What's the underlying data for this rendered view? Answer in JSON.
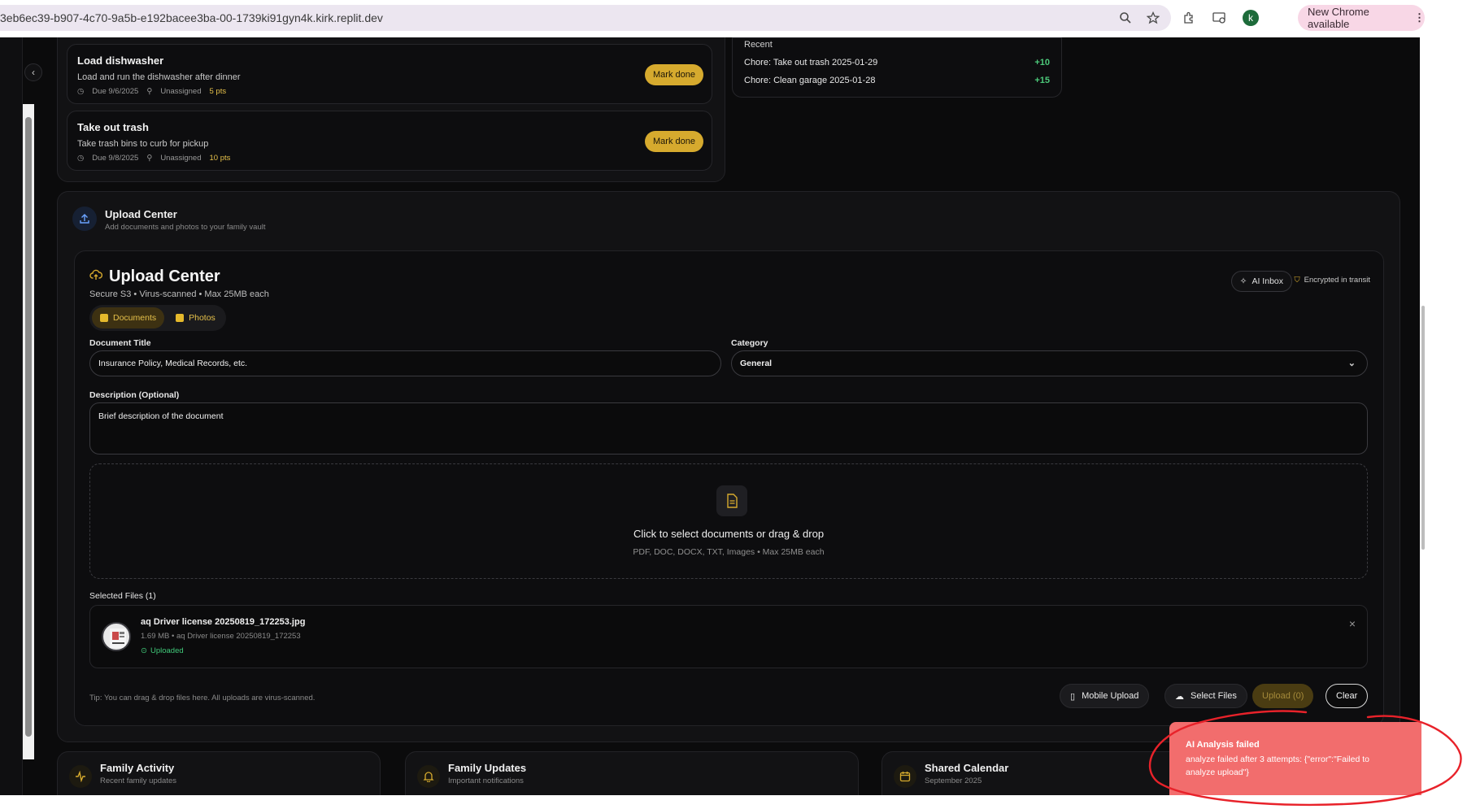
{
  "browser": {
    "url": "3eb6ec39-b907-4c70-9a5b-e192bacee3ba-00-1739ki91gyn4k.kirk.replit.dev",
    "profile_initial": "k",
    "update_label": "New Chrome available"
  },
  "chores": [
    {
      "title": "Load dishwasher",
      "desc": "Load and run the dishwasher after dinner",
      "due": "Due 9/6/2025",
      "assignee": "Unassigned",
      "pts": "5 pts",
      "action": "Mark done"
    },
    {
      "title": "Take out trash",
      "desc": "Take trash bins to curb for pickup",
      "due": "Due 9/8/2025",
      "assignee": "Unassigned",
      "pts": "10 pts",
      "action": "Mark done"
    }
  ],
  "recent": {
    "heading": "Recent",
    "rows": [
      {
        "label": "Chore: Take out trash 2025-01-29",
        "value": "+10"
      },
      {
        "label": "Chore: Clean garage 2025-01-28",
        "value": "+15"
      }
    ]
  },
  "upload_section": {
    "title": "Upload Center",
    "subtitle": "Add documents and photos to your family vault"
  },
  "upload": {
    "title": "Upload Center",
    "subtitle": "Secure S3  •  Virus-scanned  •  Max 25MB each",
    "ai_inbox": "AI Inbox",
    "encrypted": "Encrypted in transit",
    "tabs": [
      "Documents",
      "Photos"
    ],
    "doc_title_label": "Document Title",
    "doc_title_placeholder": "Insurance Policy, Medical Records, etc.",
    "category_label": "Category",
    "category_value": "General",
    "description_label": "Description (Optional)",
    "description_placeholder": "Brief description of the document",
    "dropzone_title": "Click to select documents or drag & drop",
    "dropzone_sub": "PDF, DOC, DOCX, TXT, Images  •  Max 25MB each",
    "selected_label": "Selected Files (1)",
    "file": {
      "name": "aq Driver license 20250819_172253.jpg",
      "meta": "1.69 MB  • aq Driver license 20250819_172253",
      "status": "Uploaded"
    },
    "tip": "Tip: You can drag & drop files here. All uploads are virus-scanned.",
    "buttons": {
      "mobile": "Mobile Upload",
      "select": "Select Files",
      "upload": "Upload (0)",
      "clear": "Clear"
    }
  },
  "bottom_cards": [
    {
      "title": "Family Activity",
      "sub": "Recent family updates"
    },
    {
      "title": "Family Updates",
      "sub": "Important notifications"
    },
    {
      "title": "Shared Calendar",
      "sub": "September 2025"
    }
  ],
  "toast": {
    "title": "AI Analysis failed",
    "message": "analyze failed after 3 attempts: {\"error\":\"Failed to analyze upload\"}"
  },
  "colors": {
    "accent": "#d6aa2e",
    "success": "#40c979",
    "toast": "#f26d6d",
    "annotation": "#e8222a"
  }
}
